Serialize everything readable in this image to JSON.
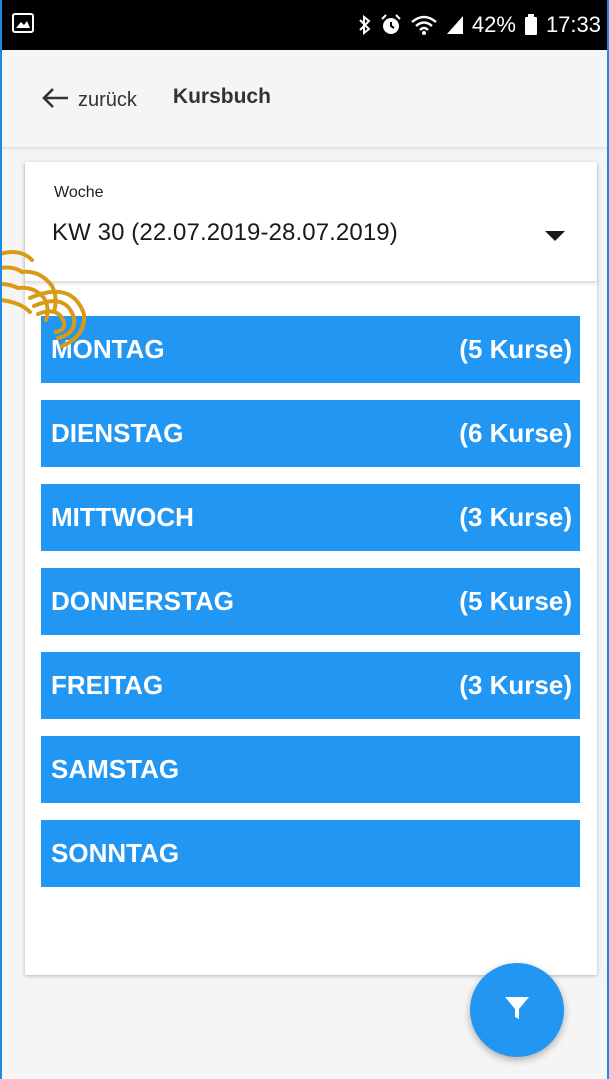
{
  "status_bar": {
    "battery_percent": "42%",
    "time": "17:33",
    "icons": [
      "image-icon",
      "bluetooth-icon",
      "alarm-icon",
      "wifi-icon",
      "signal-icon",
      "battery-icon"
    ]
  },
  "app_bar": {
    "back_label": "zurück",
    "title": "Kursbuch"
  },
  "week_select": {
    "label": "Woche",
    "value": "KW 30 (22.07.2019-28.07.2019)"
  },
  "days": [
    {
      "name": "MONTAG",
      "count": "(5 Kurse)"
    },
    {
      "name": "DIENSTAG",
      "count": "(6 Kurse)"
    },
    {
      "name": "MITTWOCH",
      "count": "(3 Kurse)"
    },
    {
      "name": "DONNERSTAG",
      "count": "(5 Kurse)"
    },
    {
      "name": "FREITAG",
      "count": "(3 Kurse)"
    },
    {
      "name": "SAMSTAG",
      "count": ""
    },
    {
      "name": "SONNTAG",
      "count": ""
    }
  ],
  "colors": {
    "accent": "#2196f3",
    "status_bar": "#000000",
    "background": "#f5f5f5",
    "tap_hint": "#d99a16"
  }
}
